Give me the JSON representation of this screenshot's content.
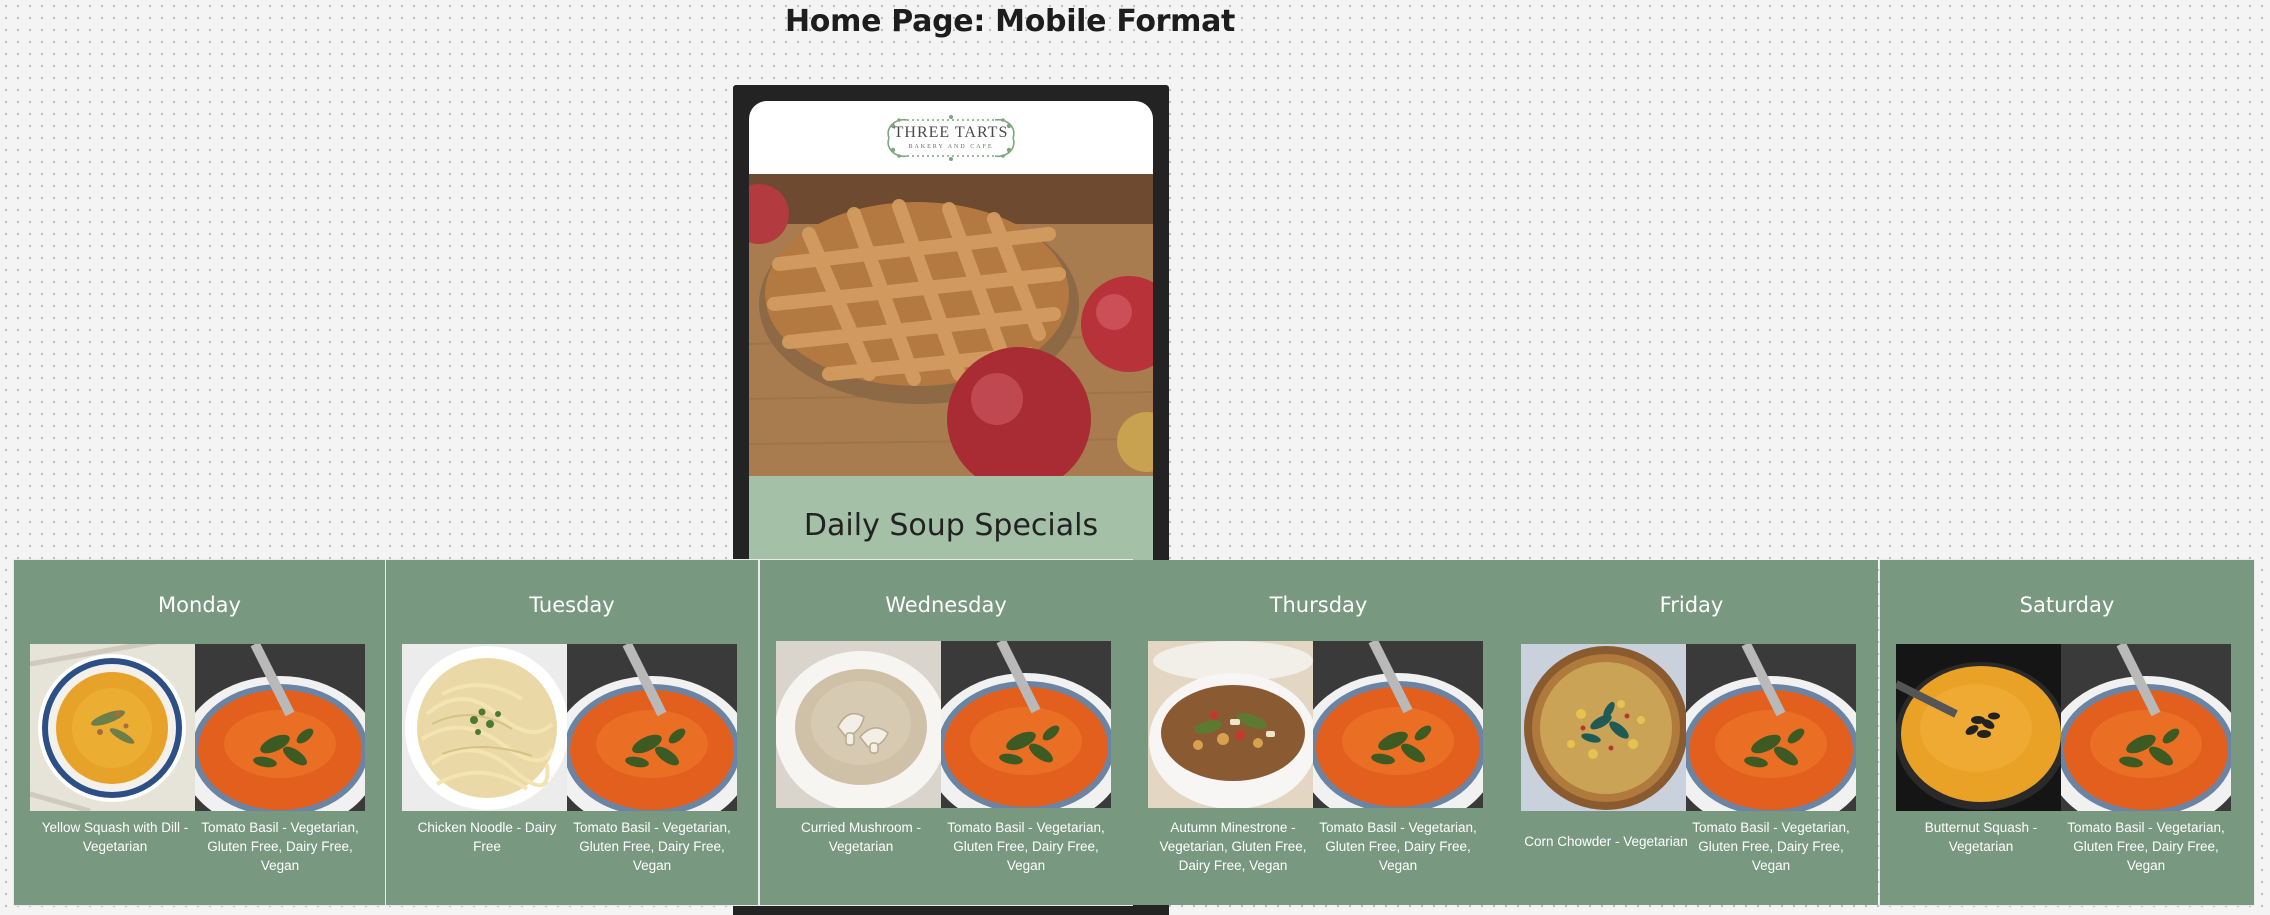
{
  "page_title": "Home Page: Mobile Format",
  "logo": {
    "name": "THREE TARTS",
    "tagline": "BAKERY AND CAFE"
  },
  "hero": {
    "image": "lattice-pie-with-apples"
  },
  "daily_specials_heading": "Daily Soup Specials",
  "colors": {
    "panel_green": "#799880",
    "band_green": "#a4c1a7",
    "phone_frame": "#232323",
    "canvas": "#f4f4f4"
  },
  "days": [
    {
      "day": "Monday",
      "soups": [
        {
          "name": "Yellow Squash with Dill - Vegetarian",
          "image": "yellow-squash-soup"
        },
        {
          "name": "Tomato Basil - Vegetarian, Gluten Free, Dairy Free, Vegan",
          "image": "tomato-basil-soup"
        }
      ]
    },
    {
      "day": "Tuesday",
      "soups": [
        {
          "name": "Chicken Noodle - Dairy Free",
          "image": "chicken-noodle-soup"
        },
        {
          "name": "Tomato Basil - Vegetarian, Gluten Free, Dairy Free, Vegan",
          "image": "tomato-basil-soup"
        }
      ]
    },
    {
      "day": "Wednesday",
      "soups": [
        {
          "name": "Curried Mushroom - Vegetarian",
          "image": "curried-mushroom-soup"
        },
        {
          "name": "Tomato Basil - Vegetarian, Gluten Free, Dairy Free, Vegan",
          "image": "tomato-basil-soup"
        }
      ]
    },
    {
      "day": "Thursday",
      "soups": [
        {
          "name": "Autumn Minestrone - Vegetarian, Gluten Free, Dairy Free, Vegan",
          "image": "autumn-minestrone-soup"
        },
        {
          "name": "Tomato Basil - Vegetarian, Gluten Free, Dairy Free, Vegan",
          "image": "tomato-basil-soup"
        }
      ]
    },
    {
      "day": "Friday",
      "soups": [
        {
          "name": "Corn Chowder - Vegetarian",
          "image": "corn-chowder-soup"
        },
        {
          "name": "Tomato Basil - Vegetarian, Gluten Free, Dairy Free, Vegan",
          "image": "tomato-basil-soup"
        }
      ]
    },
    {
      "day": "Saturday",
      "soups": [
        {
          "name": "Butternut Squash - Vegetarian",
          "image": "butternut-squash-soup"
        },
        {
          "name": "Tomato Basil - Vegetarian, Gluten Free, Dairy Free, Vegan",
          "image": "tomato-basil-soup"
        }
      ]
    }
  ]
}
